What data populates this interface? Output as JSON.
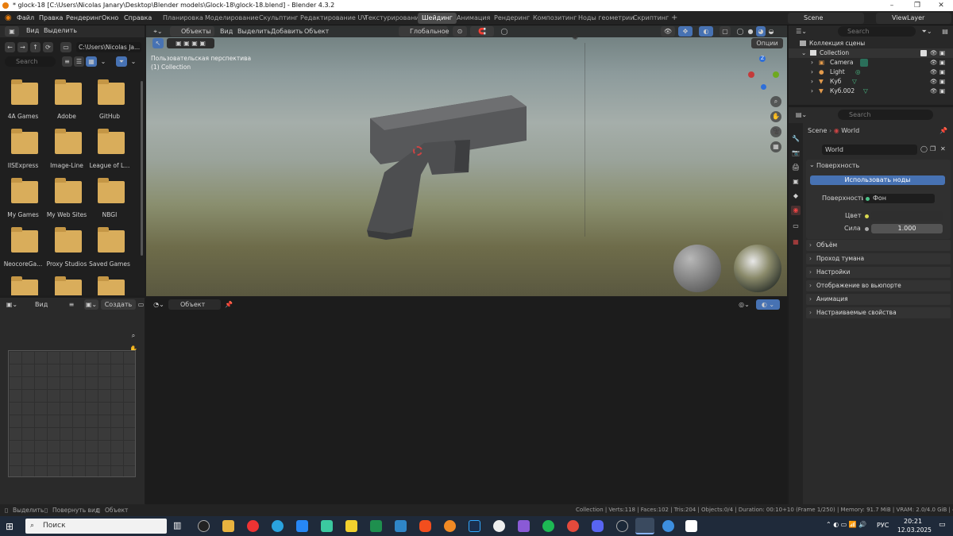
{
  "titlebar": {
    "title": "* glock-18 [C:\\Users\\Nicolas Janary\\Desktop\\Blender models\\Glock-18\\glock-18.blend] - Blender 4.3.2"
  },
  "menu": {
    "items": [
      "Файл",
      "Правка",
      "Рендеринг",
      "Окно",
      "Справка"
    ]
  },
  "workspaces": {
    "tabs": [
      "Планировка",
      "Моделирование",
      "Скульптинг",
      "Редактирование UV",
      "Текстурирование",
      "Шейдинг",
      "Анимация",
      "Рендеринг",
      "Композитинг",
      "Ноды геометрии",
      "Скриптинг",
      "+"
    ],
    "active": "Шейдинг"
  },
  "topright": {
    "scene": "Scene",
    "viewlayer": "ViewLayer"
  },
  "filebrowser": {
    "menu_view": "Вид",
    "menu_select": "Выделить",
    "path": "C:\\Users\\Nicolas Ja...",
    "search_placeholder": "Search",
    "folders": [
      "4A Games",
      "Adobe",
      "GitHub",
      "IISExpress",
      "Image-Line",
      "League of L...",
      "My Games",
      "My Web Sites",
      "NBGI",
      "NeocoreGa...",
      "Proxy Studios",
      "Saved Games",
      "",
      "",
      ""
    ]
  },
  "viewport": {
    "mode": "Объекты",
    "menu": [
      "Вид",
      "Выделить",
      "Добавить",
      "Объект"
    ],
    "orientation": "Глобальное",
    "options": "Опции",
    "info_line1": "Пользовательская перспектива",
    "info_line2": "(1) Collection"
  },
  "imgeditor": {
    "view": "Вид",
    "create": "Создать"
  },
  "nodeeditor": {
    "object": "Объект"
  },
  "outliner": {
    "search_placeholder": "Search",
    "root": "Коллекция сцены",
    "collection": "Collection",
    "items": [
      "Camera",
      "Light",
      "Куб",
      "Куб.002"
    ]
  },
  "properties": {
    "search_placeholder": "Search",
    "breadcrumb_scene": "Scene",
    "breadcrumb_world": "World",
    "world_name": "World",
    "surface_panel": "Поверхность",
    "use_nodes": "Использовать ноды",
    "surface_label": "Поверхность",
    "surface_value": "Фон",
    "color_label": "Цвет",
    "strength_label": "Сила",
    "strength_value": "1.000",
    "panels": [
      "Объём",
      "Проход тумана",
      "Настройки",
      "Отображение во вьюпорте",
      "Анимация",
      "Настраиваемые свойства"
    ]
  },
  "statusbar": {
    "select": "Выделить",
    "rotate": "Повернуть вид",
    "object": "Объект",
    "stats": "Collection | Verts:118 | Faces:102 | Tris:204 | Objects:0/4 | Duration: 00:10+10 (Frame 1/250) | Memory: 91.7 MiB | VRAM: 2.0/4.0 GiB | 4.3.2"
  },
  "taskbar": {
    "search_placeholder": "Поиск",
    "lang": "РУС",
    "time": "20:21",
    "date": "12.03.2025"
  }
}
